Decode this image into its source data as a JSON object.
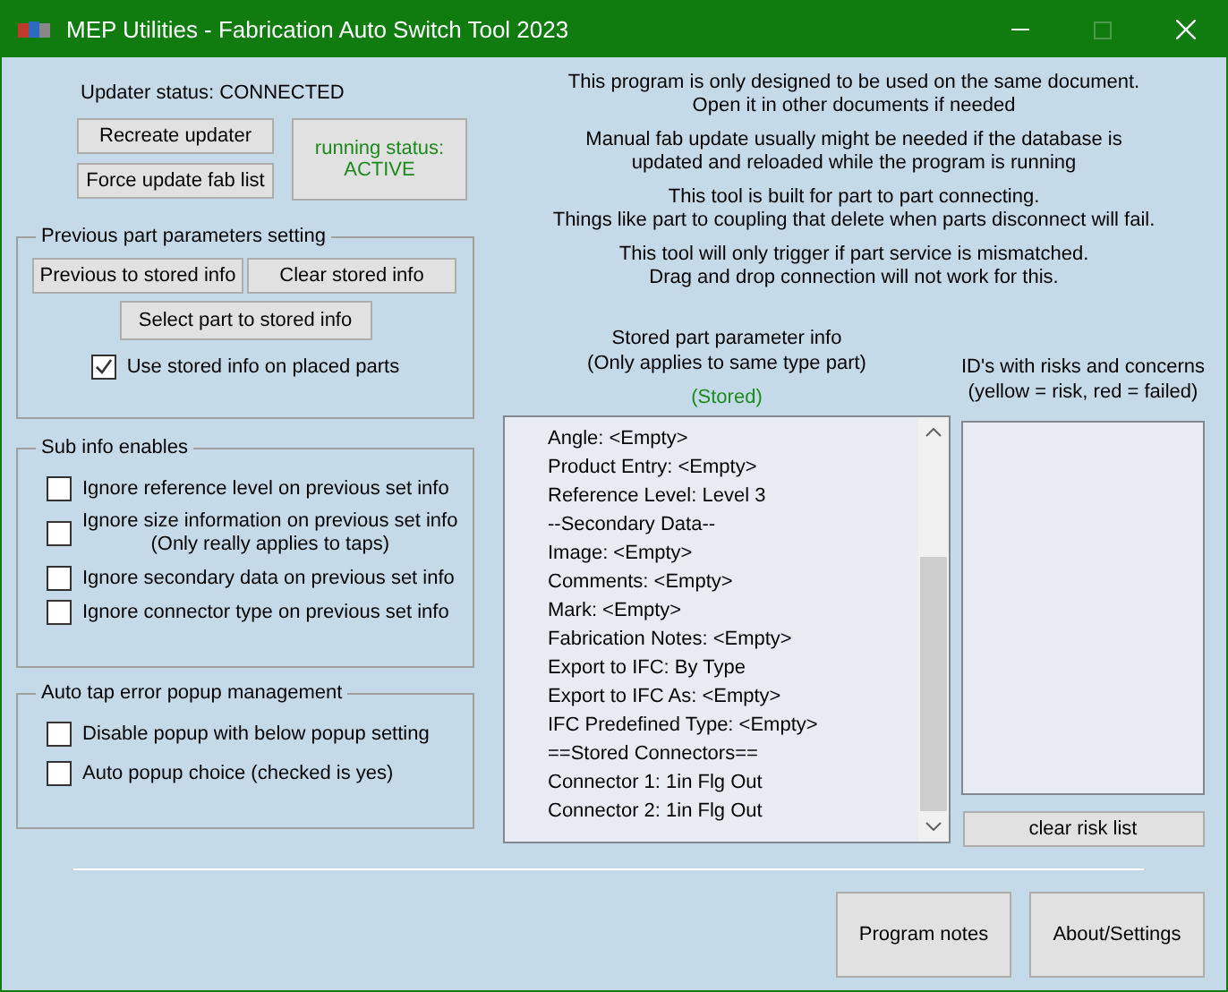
{
  "window": {
    "title": "MEP Utilities - Fabrication Auto Switch Tool 2023",
    "maximize_disabled": true
  },
  "updater": {
    "status": "Updater status: CONNECTED",
    "buttons": [
      "Recreate updater",
      "Force update fab list"
    ],
    "running_label": "running status:",
    "running_value": "ACTIVE"
  },
  "notes": [
    "This program is only designed to be used on the same document.\nOpen it in other documents if needed",
    "Manual fab update usually might be needed if the database is\nupdated and reloaded while the program is running",
    "This tool is built for part to part connecting.\nThings like part to coupling that delete when parts disconnect will fail.",
    "This tool will only trigger if part service is mismatched.\nDrag and drop connection will not work for this."
  ],
  "previous_params": {
    "title": "Previous part parameters setting",
    "buttons": [
      "Previous to stored info",
      "Clear stored info",
      "Select part to stored info"
    ],
    "use_stored": {
      "label": "Use stored info on placed parts",
      "checked": true
    }
  },
  "sub_info": {
    "title": "Sub info enables",
    "options": [
      {
        "label": "Ignore reference level on previous set info",
        "checked": false
      },
      {
        "label": "Ignore size information on previous set info",
        "note": "(Only really applies to taps)",
        "checked": false
      },
      {
        "label": "Ignore secondary data on previous set info",
        "checked": false
      },
      {
        "label": "Ignore connector type on previous set info",
        "checked": false
      }
    ]
  },
  "popup": {
    "title": "Auto tap error popup management",
    "options": [
      {
        "label": "Disable popup with below popup setting",
        "checked": false
      },
      {
        "label": "Auto popup choice (checked is yes)",
        "checked": false
      }
    ]
  },
  "stored_info": {
    "title": "Stored part parameter info\n(Only applies to same type part)",
    "status": "(Stored)",
    "lines": [
      "Angle: <Empty>",
      "Product Entry: <Empty>",
      "Reference Level: Level 3",
      "--Secondary Data--",
      "Image: <Empty>",
      "Comments: <Empty>",
      "Mark: <Empty>",
      "Fabrication Notes: <Empty>",
      "Export to IFC: By Type",
      "Export to IFC As: <Empty>",
      "IFC Predefined Type: <Empty>",
      "==Stored Connectors==",
      "Connector 1: 1in Flg Out",
      "Connector 2: 1in Flg Out"
    ]
  },
  "risks": {
    "title": "ID's with risks and concerns\n(yellow = risk, red = failed)",
    "button": "clear risk list"
  },
  "footer_buttons": [
    "Program notes",
    "About/Settings"
  ]
}
